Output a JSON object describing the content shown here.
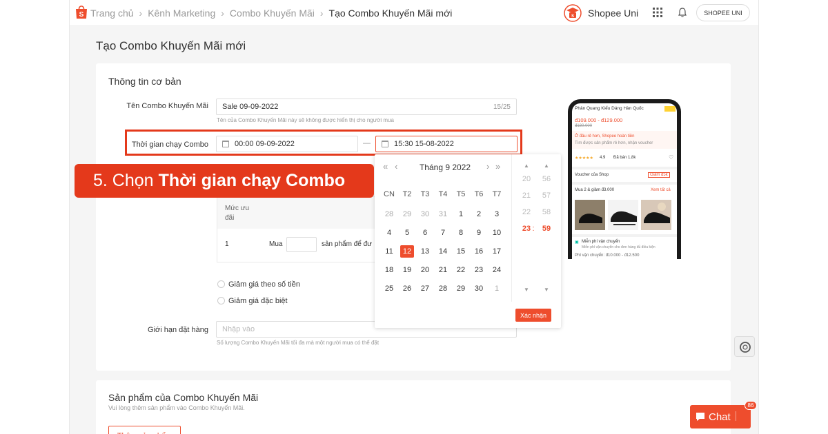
{
  "topbar": {
    "breadcrumbs": [
      "Trang chủ",
      "Kênh Marketing",
      "Combo Khuyến Mãi",
      "Tạo Combo Khuyến Mãi mới"
    ],
    "uni_label": "Shopee Uni",
    "user_label": "SHOPEE UNI",
    "brand_color": "#ee4d2d"
  },
  "page": {
    "title": "Tạo Combo Khuyến Mãi mới"
  },
  "basic_info": {
    "title": "Thông tin cơ bản",
    "name_label": "Tên Combo Khuyến Mãi",
    "name_value": "Sale 09-09-2022",
    "name_counter": "15/25",
    "name_hint": "Tên của Combo Khuyến Mãi này sẽ không được hiển thị cho người mua",
    "time_label": "Thời gian chạy Combo",
    "start_time": "00:00 09-09-2022",
    "dash": "—",
    "end_time": "15:30 15-08-2022",
    "tier_header": "Mức ưu đãi",
    "tier_row_index": "1",
    "tier_buy_label": "Mua",
    "tier_suffix": "sản phẩm để đư",
    "radio_amount": "Giảm giá theo số tiền",
    "radio_special": "Giảm giá đặc biệt",
    "limit_label": "Giới hạn đặt hàng",
    "limit_placeholder": "Nhập vào",
    "limit_hint": "Số lượng Combo Khuyến Mãi tối đa mà một người mua có thể đặt"
  },
  "datepicker": {
    "prev_year": "«",
    "prev_month": "‹",
    "next_month": "›",
    "next_year": "»",
    "title": "Tháng 9 2022",
    "weekdays": [
      "CN",
      "T2",
      "T3",
      "T4",
      "T5",
      "T6",
      "T7"
    ],
    "weeks": [
      [
        "28",
        "29",
        "30",
        "31",
        "1",
        "2",
        "3"
      ],
      [
        "4",
        "5",
        "6",
        "7",
        "8",
        "9",
        "10"
      ],
      [
        "11",
        "12",
        "13",
        "14",
        "15",
        "16",
        "17"
      ],
      [
        "18",
        "19",
        "20",
        "21",
        "22",
        "23",
        "24"
      ],
      [
        "25",
        "26",
        "27",
        "28",
        "29",
        "30",
        "1"
      ]
    ],
    "selected_day": "12",
    "hours": [
      "20",
      "21",
      "22",
      "23"
    ],
    "minutes": [
      "56",
      "57",
      "58",
      "59"
    ],
    "selected_hour": "23",
    "selected_minute": "59",
    "time_colon": ":",
    "confirm_label": "Xác nhận"
  },
  "products": {
    "title": "Sản phẩm của Combo Khuyến Mãi",
    "subtitle": "Vui lòng thêm sản phẩm vào Combo Khuyến Mãi.",
    "add_label": "Thêm sản phẩm"
  },
  "phone_preview": {
    "product_title": "Phản Quang Kiểu Dáng Hàn Quốc",
    "price_range": "đ109.000 - đ129.000",
    "old_price": "đ180.000",
    "note1": "Ở đâu rẻ hơn, Shopee hoàn tiền",
    "note2": "Tìm được sản phẩm rẻ hơn, nhận voucher",
    "rating": "4.9",
    "sold": "Đã bán 1,8k",
    "voucher_label": "Voucher của Shop",
    "voucher_tag": "Giảm đ5k",
    "combo_label": "Mua 2 & giảm đ3.000",
    "see_all": "Xem tất cả",
    "ship_label": "Miễn phí vận chuyển",
    "ship_note": "Miễn phí vận chuyển cho đơn hàng đủ điều kiện",
    "ship_fee": "Phí vận chuyển: đ10.000 - đ12.500"
  },
  "step_banner": {
    "prefix": "5. Chọn",
    "emphasis": "Thời gian chạy Combo"
  },
  "chat": {
    "label": "Chat",
    "badge": "86"
  }
}
